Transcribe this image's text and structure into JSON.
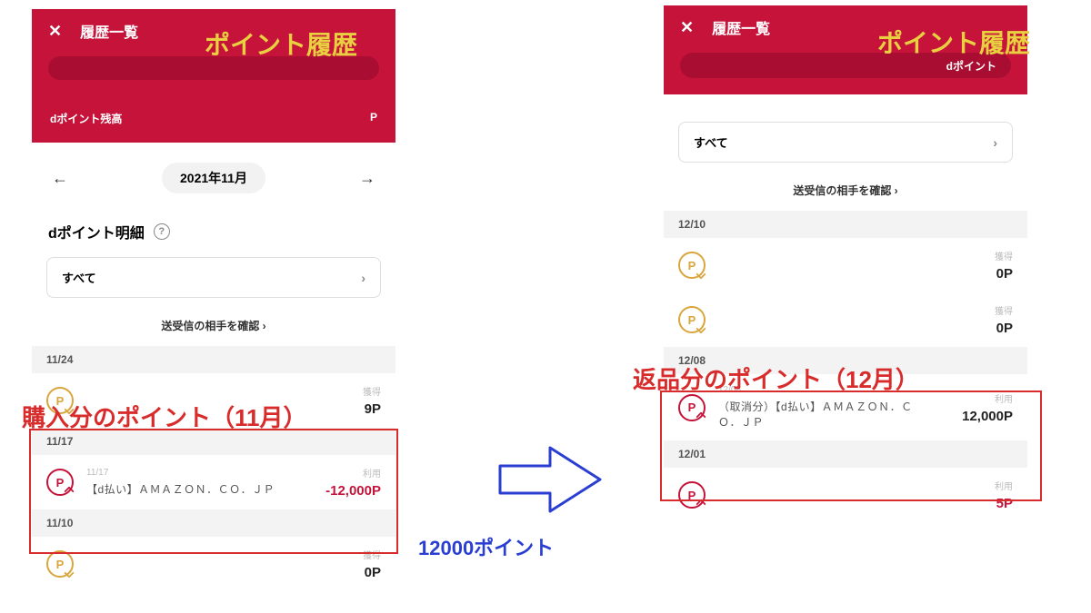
{
  "left": {
    "header": {
      "title": "履歴一覧",
      "balance_label": "dポイント残高",
      "balance_symbol": "P"
    },
    "month_nav": {
      "label": "2021年11月"
    },
    "section_title": "dポイント明細",
    "filter": {
      "label": "すべて"
    },
    "confirm_link": "送受信の相手を確認",
    "dates": {
      "d1": "11/24",
      "d2": "11/17",
      "d3": "11/10"
    },
    "txn1": {
      "kind": "獲得",
      "amount": "9P"
    },
    "txn2": {
      "sub": "11/17",
      "title": "【d払い】ＡＭＡＺＯＮ．ＣＯ．ＪＰ",
      "kind": "利用",
      "amount": "-12,000P"
    },
    "txn3": {
      "kind": "獲得",
      "amount": "0P"
    }
  },
  "right": {
    "header": {
      "title": "履歴一覧",
      "tab": "dポイント"
    },
    "filter": {
      "label": "すべて"
    },
    "confirm_link": "送受信の相手を確認",
    "dates": {
      "d1": "12/10",
      "d2": "12/08",
      "d3": "12/01"
    },
    "txn1": {
      "kind": "獲得",
      "amount": "0P"
    },
    "txn2": {
      "kind": "獲得",
      "amount": "0P"
    },
    "txn3": {
      "sub": "12/08",
      "title": "（取消分）【d払い】ＡＭＡＺＯＮ．ＣＯ．ＪＰ",
      "kind": "利用",
      "amount": "12,000P"
    },
    "txn4": {
      "kind": "利用",
      "amount": "5P"
    }
  },
  "annotations": {
    "left_title": "ポイント履歴",
    "right_title": "ポイント履歴",
    "left_caption": "購入分のポイント（11月）",
    "right_caption": "返品分のポイント（12月）",
    "points_text": "12000ポイント"
  }
}
